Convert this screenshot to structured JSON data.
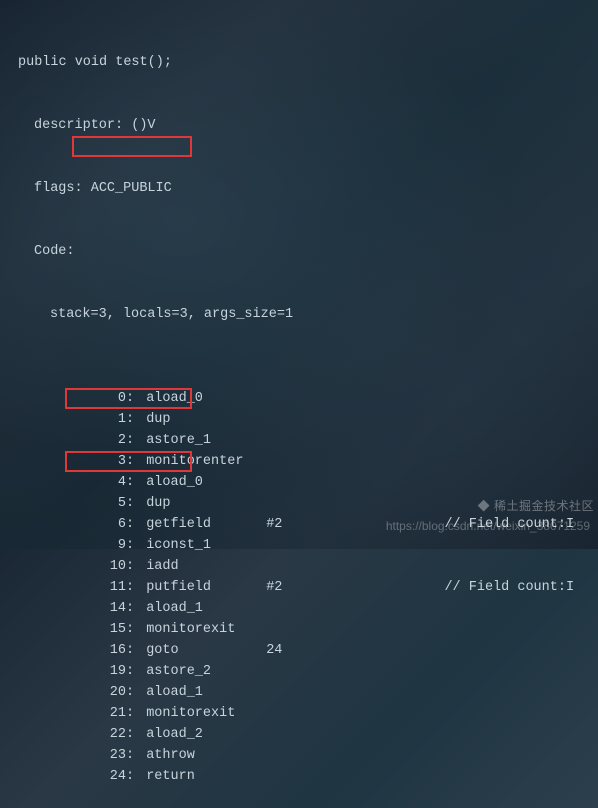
{
  "header": {
    "signature": "public void test();",
    "descriptor_label": "descriptor:",
    "descriptor_value": "()V",
    "flags_label": "flags:",
    "flags_value": "ACC_PUBLIC",
    "code_label": "Code:",
    "stack_line": "stack=3, locals=3, args_size=1"
  },
  "instructions": [
    {
      "offset": "0",
      "name": "aload_0",
      "arg": "",
      "comment": ""
    },
    {
      "offset": "1",
      "name": "dup",
      "arg": "",
      "comment": ""
    },
    {
      "offset": "2",
      "name": "astore_1",
      "arg": "",
      "comment": ""
    },
    {
      "offset": "3",
      "name": "monitorenter",
      "arg": "",
      "comment": ""
    },
    {
      "offset": "4",
      "name": "aload_0",
      "arg": "",
      "comment": ""
    },
    {
      "offset": "5",
      "name": "dup",
      "arg": "",
      "comment": ""
    },
    {
      "offset": "6",
      "name": "getfield",
      "arg": "#2",
      "comment": "// Field count:I"
    },
    {
      "offset": "9",
      "name": "iconst_1",
      "arg": "",
      "comment": ""
    },
    {
      "offset": "10",
      "name": "iadd",
      "arg": "",
      "comment": ""
    },
    {
      "offset": "11",
      "name": "putfield",
      "arg": "#2",
      "comment": "// Field count:I"
    },
    {
      "offset": "14",
      "name": "aload_1",
      "arg": "",
      "comment": ""
    },
    {
      "offset": "15",
      "name": "monitorexit",
      "arg": "",
      "comment": ""
    },
    {
      "offset": "16",
      "name": "goto",
      "arg": "24",
      "comment": ""
    },
    {
      "offset": "19",
      "name": "astore_2",
      "arg": "",
      "comment": ""
    },
    {
      "offset": "20",
      "name": "aload_1",
      "arg": "",
      "comment": ""
    },
    {
      "offset": "21",
      "name": "monitorexit",
      "arg": "",
      "comment": ""
    },
    {
      "offset": "22",
      "name": "aload_2",
      "arg": "",
      "comment": ""
    },
    {
      "offset": "23",
      "name": "athrow",
      "arg": "",
      "comment": ""
    },
    {
      "offset": "24",
      "name": "return",
      "arg": "",
      "comment": ""
    }
  ],
  "highlights": [
    {
      "offset": "3",
      "name": "monitorenter"
    },
    {
      "offset": "15",
      "name": "monitorexit"
    },
    {
      "offset": "21",
      "name": "monitorexit"
    }
  ],
  "watermark": {
    "brand": "稀土掘金技术社区",
    "url": "https://blog.csdn.net/weixin_38071259"
  },
  "colors": {
    "text": "#c8d4dc",
    "highlight_border": "#e03838"
  }
}
